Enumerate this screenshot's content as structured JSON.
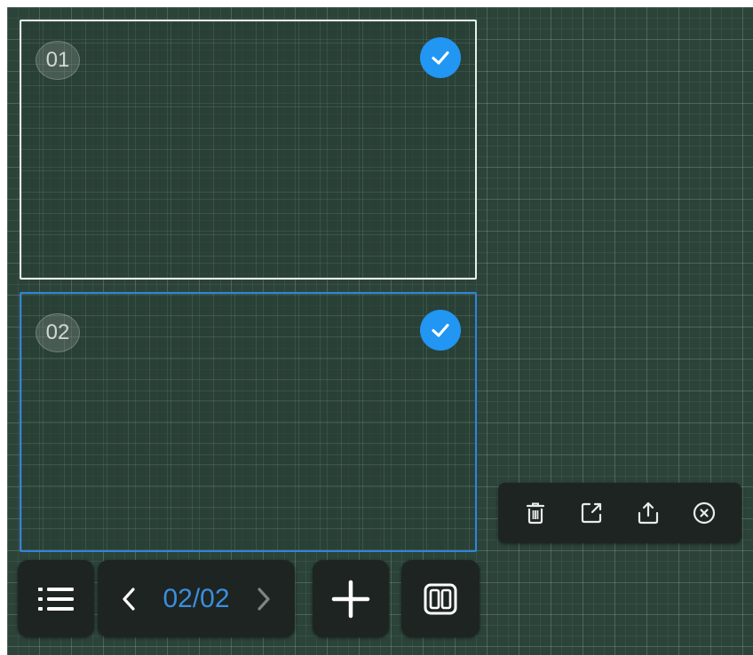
{
  "pages": [
    {
      "number": "01",
      "selected": true
    },
    {
      "number": "02",
      "selected": true
    }
  ],
  "pagination": {
    "counter": "02/02"
  },
  "icons": {
    "menu": "list-icon",
    "prev": "chevron-left-icon",
    "next": "chevron-right-icon",
    "add": "plus-icon",
    "layout": "dual-page-icon",
    "delete": "trash-icon",
    "open": "open-external-icon",
    "share": "share-upload-icon",
    "close": "close-circle-icon",
    "check": "check-icon"
  },
  "colors": {
    "board": "#2b4339",
    "accent": "#2196f3",
    "selected_border": "#2e86de",
    "counter_text": "#3a8fe0",
    "toolbar_bg": "#1e2421"
  }
}
